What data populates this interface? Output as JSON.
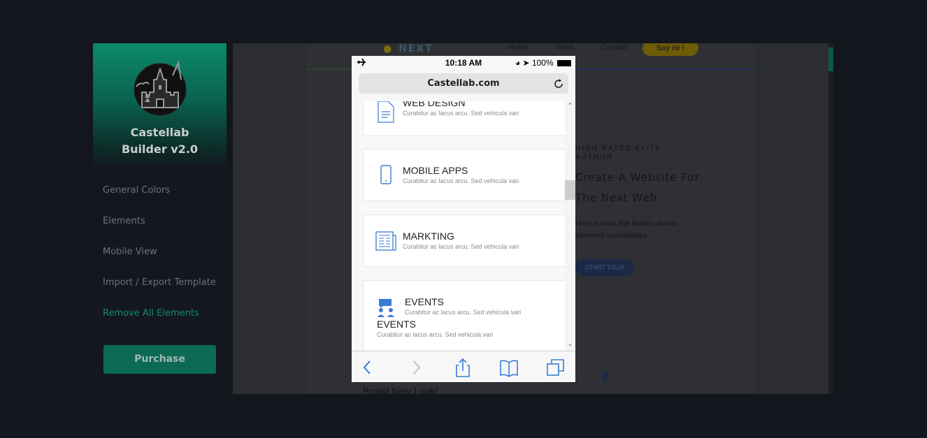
{
  "sidebar": {
    "brand_line1": "Castellab",
    "brand_line2": "Builder v2.0",
    "menu": [
      {
        "label": "General Colors"
      },
      {
        "label": "Elements"
      },
      {
        "label": "Mobile View"
      },
      {
        "label": "Import / Export Template"
      },
      {
        "label": "Remove All Elements"
      }
    ],
    "purchase_label": "Purchase"
  },
  "site": {
    "logo_text": "NEXT",
    "nav": [
      "Home",
      "Work",
      "Contact"
    ],
    "say_hi": "Say Hi !",
    "hero_eyebrow": "HIGH RATED ELITE AUTHOR",
    "hero_title_1": "Create A Website For",
    "hero_title_2": "The Next Web.",
    "hero_text": "Have in mind that Blade's demos represent opossibilities.",
    "start_tour": "START TOUR",
    "brand_new": "Brand New Look!"
  },
  "phone": {
    "time": "10:18 AM",
    "battery": "100%",
    "url": "Castellab.com",
    "cards": [
      {
        "title": "WEB DESIGN",
        "desc": "Curabitur ac lacus arcu. Sed vehicula vari",
        "icon": "document-icon"
      },
      {
        "title": "MOBILE APPS",
        "desc": "Curabitur ac lacus arcu. Sed vehicula vari",
        "icon": "mobile-icon"
      },
      {
        "title": "MARKTING",
        "desc": "Curabitur ac lacus arcu. Sed vehicula vari",
        "icon": "newspaper-icon"
      },
      {
        "title": "EVENTS",
        "desc": "Curabitur ac lacus arcu. Sed vehicula vari",
        "icon": "events-icon"
      },
      {
        "title": "EVENTS",
        "desc": "Curabitur ac lacus arcu. Sed vehicula vari"
      }
    ]
  },
  "colors": {
    "accent": "#0c8d6a",
    "icon_blue": "#3a7bd5",
    "background": "#13161d"
  }
}
